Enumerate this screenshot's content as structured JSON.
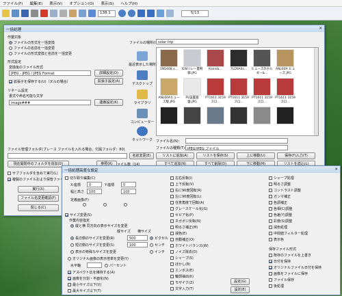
{
  "menu": [
    "ファイル(F)",
    "編集(E)",
    "表示(V)",
    "オプション(O)",
    "表示(S)",
    "ヘルプ(H)"
  ],
  "toolbar": {
    "zoom": "138.1",
    "page": "5/13"
  },
  "main_dialog": {
    "title": "一括処理",
    "target_label": "作業対象",
    "target_options": [
      "ファイルの形式を一括変換",
      "ファイルの名前を一括変更",
      "ファイルの形式変換と名前を一括変更"
    ],
    "target_selected": 0,
    "format_group": "形式設定",
    "format_label": "変換後のファイル形式",
    "format_value": "JPEG - JPEG / JPEG Format",
    "format_btn": "詳細設定(O)",
    "ext_check": "拡張子を保存する(U)（ヌルの場合）",
    "ext_btn": "拡張子設定(A)",
    "rename_group": "リネーム設定",
    "rename_label": "書式や命名可能な文字",
    "rename_value": "image###",
    "rename_btn": "連番設定(K)",
    "places": [
      "最近表示した場所",
      "デスクトップ",
      "ライブラリ",
      "コンピューター",
      "ネットワーク"
    ],
    "place_label": "ファイルの場所(I):",
    "folder": "solar trip",
    "thumbs": [
      "1N5408.x...",
      "IGNリレー量制御.JPG",
      "Kainda...",
      "7LD0A0s...",
      "ヒューズのホルダー&...",
      "ANL60A ヒューズ.JPG",
      "ANL60Aヒューズ版.JPG",
      "PV設置基盤.JPG",
      "PT1611 3159 ス口...",
      "PT1611 3159 ス口...",
      "PT1611 3159 ス口...",
      "PT1611 3159 ス口...",
      "",
      "",
      "",
      "",
      "",
      ""
    ],
    "filename_label": "ファイル名(N):",
    "filetype_label": "ファイルの種類(T):",
    "filetype_value": "JPEG/JPEG ファイル",
    "mgmt_label": "ファイル管理フォルダ(ブレース ファイルを入れる場合、付属フォルダ：80)",
    "mgmt_btn": "名前変更(E)",
    "list_btns": [
      "リストに追加(A)",
      "リストを保存(S)",
      "上に移動(U)",
      "保存(F)入力(T)",
      "すべて追加(N)",
      "すべて削除(D)",
      "下に移動(M)",
      "リストを読込(L)"
    ],
    "count_label": "作業ファイル数（14）",
    "folder_btn": "現在開閉中のフォルダを追加(D)",
    "ref_btn": "参照(R)",
    "sub_check1": "サブフォルダを含めて実行(L)",
    "sub_check2": "複製のファイルおより保管ファイル",
    "run_btn": "実行(X)",
    "list_btn": "ファイル名変更確認(F)",
    "close_btn": "閉じる(C)"
  },
  "adv_dialog": {
    "title": "一括処理高度な設定",
    "col1": [
      "切り取り編集(C)",
      "X-座標",
      "Y-座標",
      "幅と高さ",
      "定義画像(F)",
      "サイズ変更(S)",
      "作業内容指定",
      "縦と横 同方向の表示サイズを変更",
      "縦サイズ",
      "横サイズ",
      "長辺側のサイズを変更(R)",
      "短辺側のサイズを変更(S)",
      "表示の特殊なサイズを変更",
      "オリジナル画像の表示倍率を変更(Y)",
      "水平軸",
      "アスペクト比を維持する(A)",
      "画像を分割・平面化(N)",
      "最小サイズ以下(V)",
      "最大サイズ以下(T)"
    ],
    "val_x": "0",
    "val_y": "0",
    "val_w": "100",
    "val_h": "100",
    "val_long": "500",
    "val_short": "100",
    "unit_px": "ピクセル",
    "unit_cm": "センチ",
    "unit_inch": "インチ",
    "unit_pct": "パーセント",
    "col2": [
      "左右反転(I)",
      "上下反転(V)",
      "右に90度回転(R)",
      "左に90度回転(L)",
      "任意角度で回転(A)",
      "グレースケール化(G)",
      "セピア化(P)",
      "ネガポジ反転(N)",
      "明るさ補正(M)",
      "減色(E)",
      "自動補正(O)",
      "ホワイトバランス(W)",
      "ノイズ除去(D)",
      "シャープ(S)",
      "ぼかし(B)",
      "エンボス(E)",
      "輪郭抽出(K)",
      "モザイク(Z)",
      "文字入力(T)"
    ],
    "col3": [
      "シャープ処理",
      "明るさ調整",
      "コントラスト調整",
      "ガンマ補正",
      "色調補正",
      "色相(C)調整",
      "色差(Y)調整",
      "彩度(S)調整",
      "減色処理",
      "中間値フィルター処理",
      "表示色",
      "保存ファイル形式",
      "既存のファイルを上書き",
      "日付を保持",
      "オリジナルファイル日付を保持",
      "画像をファイルに保存",
      "ファイル保存",
      "後処理"
    ],
    "setting_btn": "設定(G)",
    "setting_btn2": "設定(E)"
  }
}
